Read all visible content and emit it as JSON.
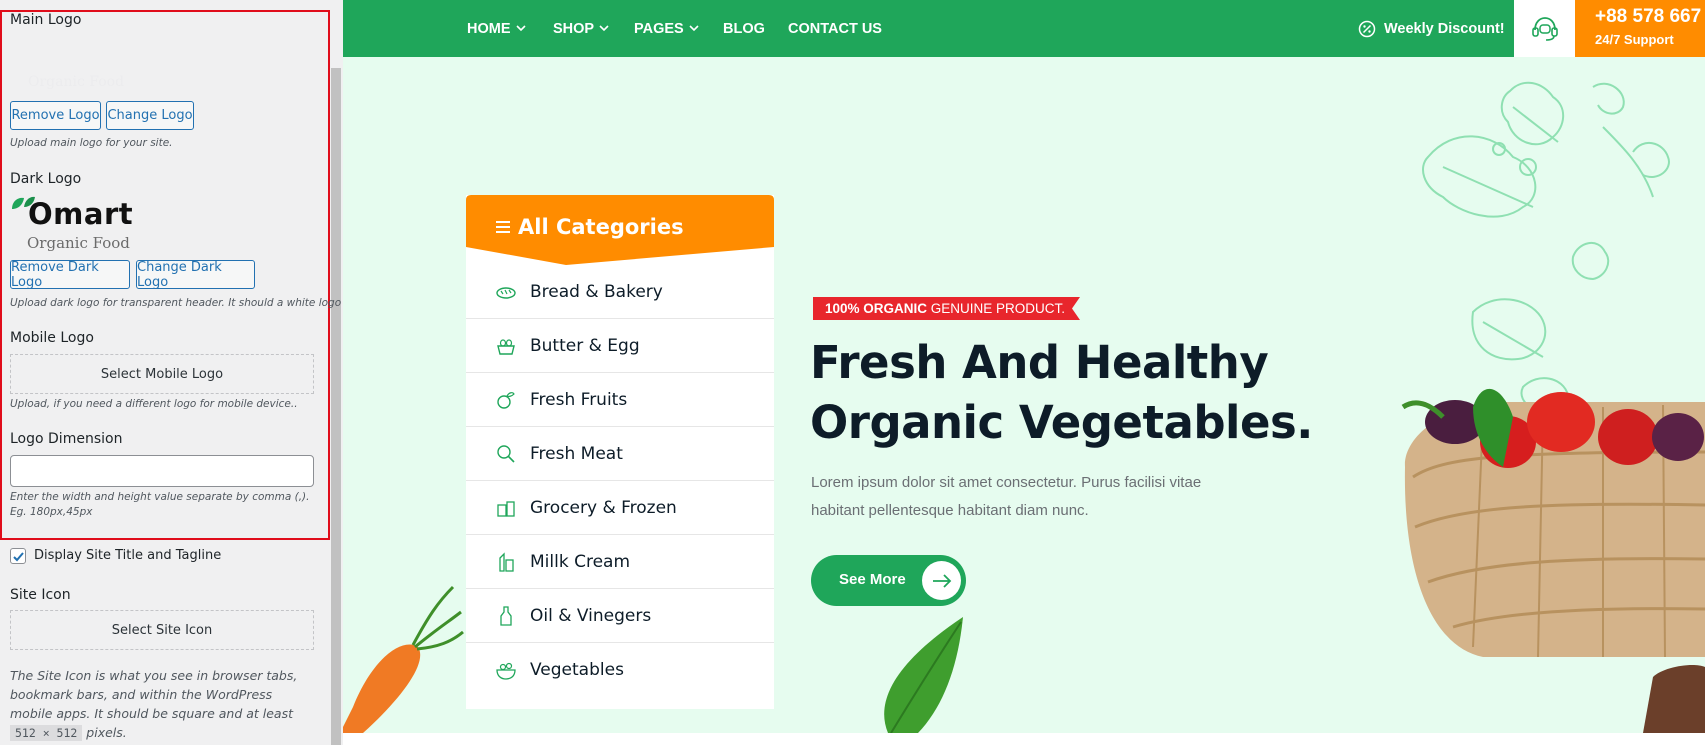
{
  "customizer": {
    "main_logo": {
      "title": "Main Logo",
      "ghost_text": "Organic Food",
      "remove_label": "Remove Logo",
      "change_label": "Change Logo",
      "description": "Upload main logo for your site."
    },
    "dark_logo": {
      "title": "Dark Logo",
      "logo_word": "Omart",
      "logo_tagline": "Organic Food",
      "remove_label": "Remove Dark Logo",
      "change_label": "Change Dark Logo",
      "description": "Upload dark logo for transparent header. It should a white logo"
    },
    "mobile_logo": {
      "title": "Mobile Logo",
      "select_label": "Select Mobile Logo",
      "description": "Upload, if you need a different logo for mobile device.."
    },
    "logo_dimension": {
      "title": "Logo Dimension",
      "value": "",
      "description": "Enter the width and height value separate by comma (,). Eg. 180px,45px"
    },
    "display_title": {
      "label": "Display Site Title and Tagline",
      "checked": true
    },
    "site_icon": {
      "title": "Site Icon",
      "select_label": "Select Site Icon",
      "desc_before": "The Site Icon is what you see in browser tabs, bookmark bars, and within the WordPress mobile apps. It should be square and at least",
      "desc_code": "512 × 512",
      "desc_after": "pixels."
    }
  },
  "site": {
    "nav": [
      {
        "label": "HOME",
        "dropdown": true
      },
      {
        "label": "SHOP",
        "dropdown": true
      },
      {
        "label": "PAGES",
        "dropdown": true
      },
      {
        "label": "BLOG",
        "dropdown": false
      },
      {
        "label": "CONTACT US",
        "dropdown": false
      }
    ],
    "discount": "Weekly Discount!",
    "support": {
      "phone": "+88 578 667",
      "subtitle": "24/7 Support"
    },
    "categories": {
      "title": "All Categories",
      "items": [
        {
          "label": "Bread & Bakery",
          "icon": "bread-icon"
        },
        {
          "label": "Butter & Egg",
          "icon": "egg-basket-icon"
        },
        {
          "label": "Fresh Fruits",
          "icon": "fruit-icon"
        },
        {
          "label": "Fresh Meat",
          "icon": "meat-icon"
        },
        {
          "label": "Grocery & Frozen",
          "icon": "grocery-icon"
        },
        {
          "label": "Millk Cream",
          "icon": "milk-icon"
        },
        {
          "label": "Oil & Vinegers",
          "icon": "oil-bottle-icon"
        },
        {
          "label": "Vegetables",
          "icon": "vegetable-bowl-icon"
        }
      ]
    },
    "hero": {
      "tag_bold": "100% ORGANIC",
      "tag_rest": "GENUINE PRODUCT.",
      "headline_1": "Fresh And Healthy",
      "headline_2": "Organic Vegetables.",
      "description": "Lorem ipsum dolor sit amet consectetur. Purus facilisi vitae habitant pellentesque habitant diam nunc.",
      "button_label": "See More"
    },
    "colors": {
      "brand_green": "#1fa65a",
      "accent_orange": "#ff8c00",
      "hero_bg": "#e6fcef",
      "tag_red": "#e8262c",
      "text_dark": "#0d1c28",
      "highlight_border": "#e00d1b"
    }
  }
}
